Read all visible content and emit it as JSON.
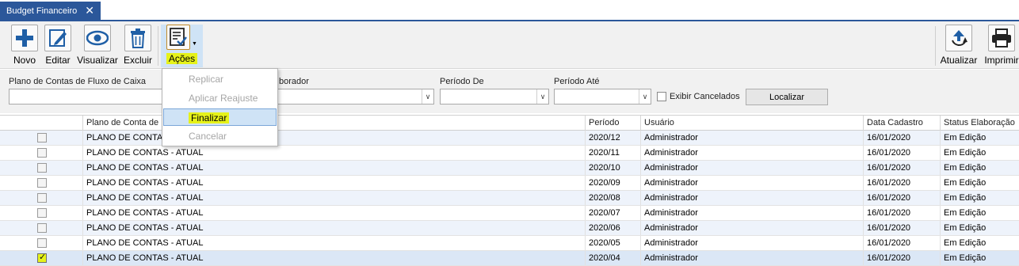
{
  "tab": {
    "title": "Budget Financeiro",
    "close": "✕"
  },
  "toolbar": {
    "novo": "Novo",
    "editar": "Editar",
    "visualizar": "Visualizar",
    "excluir": "Excluir",
    "acoes": "Ações",
    "atualizar": "Atualizar",
    "imprimir": "Imprimir"
  },
  "filters": {
    "plano_label": "Plano de Contas de Fluxo de Caixa",
    "elaborador_label": "borador",
    "periodo_de_label": "Período De",
    "periodo_ate_label": "Período Até",
    "exibir_cancelados": "Exibir Cancelados",
    "localizar": "Localizar"
  },
  "menu": {
    "items": [
      "Replicar",
      "Aplicar Reajuste",
      "Finalizar",
      "Cancelar"
    ]
  },
  "grid": {
    "headers": [
      "Plano de Conta de F",
      "Período",
      "Usuário",
      "Data Cadastro",
      "Status Elaboração"
    ],
    "rows": [
      {
        "plano": "PLANO DE CONTAS",
        "periodo": "2020/12",
        "usuario": "Administrador",
        "data": "16/01/2020",
        "status": "Em Edição",
        "checked": false
      },
      {
        "plano": "PLANO DE CONTAS - ATUAL",
        "periodo": "2020/11",
        "usuario": "Administrador",
        "data": "16/01/2020",
        "status": "Em Edição",
        "checked": false
      },
      {
        "plano": "PLANO DE CONTAS - ATUAL",
        "periodo": "2020/10",
        "usuario": "Administrador",
        "data": "16/01/2020",
        "status": "Em Edição",
        "checked": false
      },
      {
        "plano": "PLANO DE CONTAS - ATUAL",
        "periodo": "2020/09",
        "usuario": "Administrador",
        "data": "16/01/2020",
        "status": "Em Edição",
        "checked": false
      },
      {
        "plano": "PLANO DE CONTAS - ATUAL",
        "periodo": "2020/08",
        "usuario": "Administrador",
        "data": "16/01/2020",
        "status": "Em Edição",
        "checked": false
      },
      {
        "plano": "PLANO DE CONTAS - ATUAL",
        "periodo": "2020/07",
        "usuario": "Administrador",
        "data": "16/01/2020",
        "status": "Em Edição",
        "checked": false
      },
      {
        "plano": "PLANO DE CONTAS - ATUAL",
        "periodo": "2020/06",
        "usuario": "Administrador",
        "data": "16/01/2020",
        "status": "Em Edição",
        "checked": false
      },
      {
        "plano": "PLANO DE CONTAS - ATUAL",
        "periodo": "2020/05",
        "usuario": "Administrador",
        "data": "16/01/2020",
        "status": "Em Edição",
        "checked": false
      },
      {
        "plano": "PLANO DE CONTAS - ATUAL",
        "periodo": "2020/04",
        "usuario": "Administrador",
        "data": "16/01/2020",
        "status": "Em Edição",
        "checked": true
      }
    ]
  },
  "colors": {
    "accent": "#2b579a",
    "highlight": "#e6f21a",
    "menu_hover": "#cfe3f6"
  },
  "icons": {
    "novo": "plus-icon",
    "editar": "pencil-icon",
    "visualizar": "eye-icon",
    "excluir": "trash-icon",
    "acoes": "checklist-icon",
    "atualizar": "refresh-icon",
    "imprimir": "printer-icon"
  }
}
